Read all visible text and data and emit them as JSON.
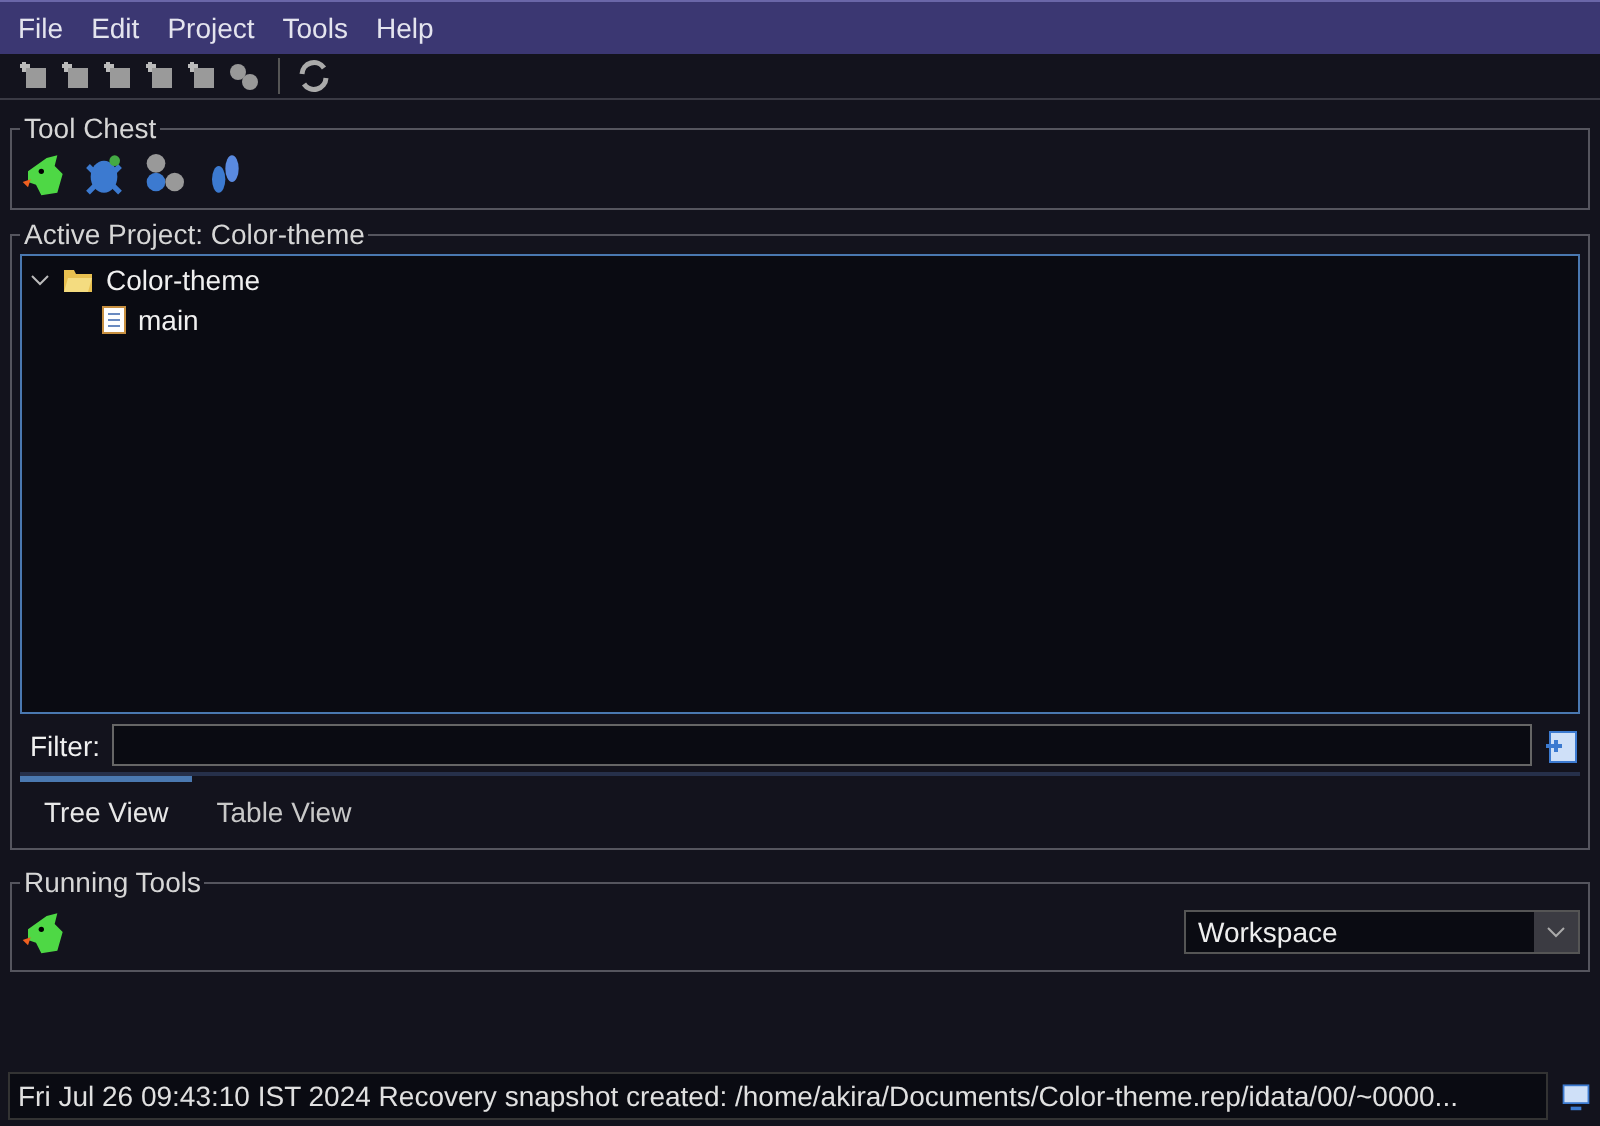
{
  "menu": [
    "File",
    "Edit",
    "Project",
    "Tools",
    "Help"
  ],
  "tool_chest": {
    "title": "Tool Chest"
  },
  "project": {
    "title": "Active Project: Color-theme",
    "tree": [
      {
        "label": "Color-theme",
        "kind": "folder",
        "expanded": true,
        "children": [
          {
            "label": "main",
            "kind": "file"
          }
        ]
      }
    ],
    "filter": {
      "label": "Filter:"
    },
    "tabs": [
      {
        "label": "Tree View",
        "selected": true
      },
      {
        "label": "Table View",
        "selected": false
      }
    ]
  },
  "running_tools": {
    "title": "Running Tools",
    "workspace": "Workspace"
  },
  "status_bar": "Fri Jul 26 09:43:10 IST 2024 Recovery snapshot created: /home/akira/Documents/Color-theme.rep/idata/00/~0000..."
}
